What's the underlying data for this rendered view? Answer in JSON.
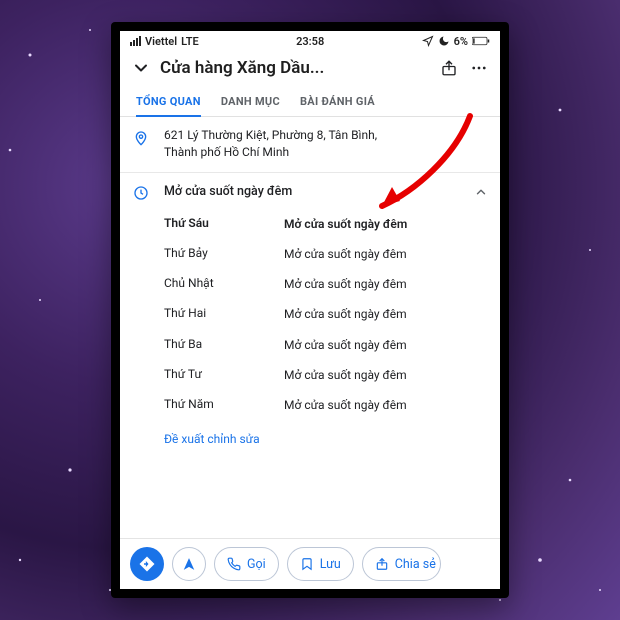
{
  "status": {
    "carrier": "Viettel",
    "network": "LTE",
    "time": "23:58",
    "battery": "6%"
  },
  "header": {
    "title": "Cửa hàng Xăng Dầu..."
  },
  "tabs": {
    "overview": "TỔNG QUAN",
    "menu": "DANH MỤC",
    "reviews": "BÀI ĐÁNH GIÁ"
  },
  "address": {
    "line1": "621 Lý Thường Kiệt, Phường 8, Tân Bình,",
    "line2": "Thành phố Hồ Chí Minh"
  },
  "hours": {
    "summary": "Mở cửa suốt ngày đêm",
    "days": [
      {
        "day": "Thứ Sáu",
        "value": "Mở cửa suốt ngày đêm",
        "bold": true
      },
      {
        "day": "Thứ Bảy",
        "value": "Mở cửa suốt ngày đêm"
      },
      {
        "day": "Chủ Nhật",
        "value": "Mở cửa suốt ngày đêm"
      },
      {
        "day": "Thứ Hai",
        "value": "Mở cửa suốt ngày đêm"
      },
      {
        "day": "Thứ Ba",
        "value": "Mở cửa suốt ngày đêm"
      },
      {
        "day": "Thứ Tư",
        "value": "Mở cửa suốt ngày đêm"
      },
      {
        "day": "Thứ Năm",
        "value": "Mở cửa suốt ngày đêm"
      }
    ],
    "suggest_edit": "Đề xuất chỉnh sửa"
  },
  "actions": {
    "call": "Gọi",
    "save": "Lưu",
    "share": "Chia sẻ"
  },
  "icons": {
    "chevron_down": "chevron-down-icon",
    "share": "share-icon",
    "more": "more-icon",
    "pin": "location-pin-icon",
    "clock": "clock-icon",
    "chevron_up": "chevron-up-icon",
    "directions": "directions-icon",
    "start": "navigate-icon",
    "phone": "phone-icon",
    "bookmark": "bookmark-icon"
  }
}
